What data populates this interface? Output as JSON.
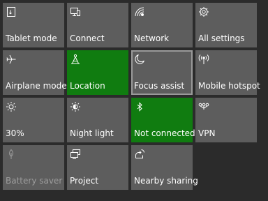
{
  "colors": {
    "background": "#2b2b2b",
    "tile": "#5d5d5d",
    "tile_active": "#107c10",
    "text": "#ffffff",
    "text_disabled": "#9d9d9d"
  },
  "tiles": [
    {
      "label": "Tablet mode",
      "icon": "tablet-mode-icon",
      "state": "off"
    },
    {
      "label": "Connect",
      "icon": "connect-icon",
      "state": "off"
    },
    {
      "label": "Network",
      "icon": "network-icon",
      "state": "off"
    },
    {
      "label": "All settings",
      "icon": "gear-icon",
      "state": "off"
    },
    {
      "label": "Airplane mode",
      "icon": "airplane-icon",
      "state": "off"
    },
    {
      "label": "Location",
      "icon": "location-icon",
      "state": "on"
    },
    {
      "label": "Focus assist",
      "icon": "moon-icon",
      "state": "off"
    },
    {
      "label": "Mobile hotspot",
      "icon": "hotspot-icon",
      "state": "off"
    },
    {
      "label": "30%",
      "icon": "brightness-icon",
      "state": "off"
    },
    {
      "label": "Night light",
      "icon": "night-light-icon",
      "state": "off"
    },
    {
      "label": "Not connected",
      "icon": "bluetooth-icon",
      "state": "on"
    },
    {
      "label": "VPN",
      "icon": "vpn-icon",
      "state": "off"
    },
    {
      "label": "Battery saver",
      "icon": "battery-saver-icon",
      "state": "disabled"
    },
    {
      "label": "Project",
      "icon": "project-icon",
      "state": "off"
    },
    {
      "label": "Nearby sharing",
      "icon": "nearby-sharing-icon",
      "state": "off"
    }
  ]
}
